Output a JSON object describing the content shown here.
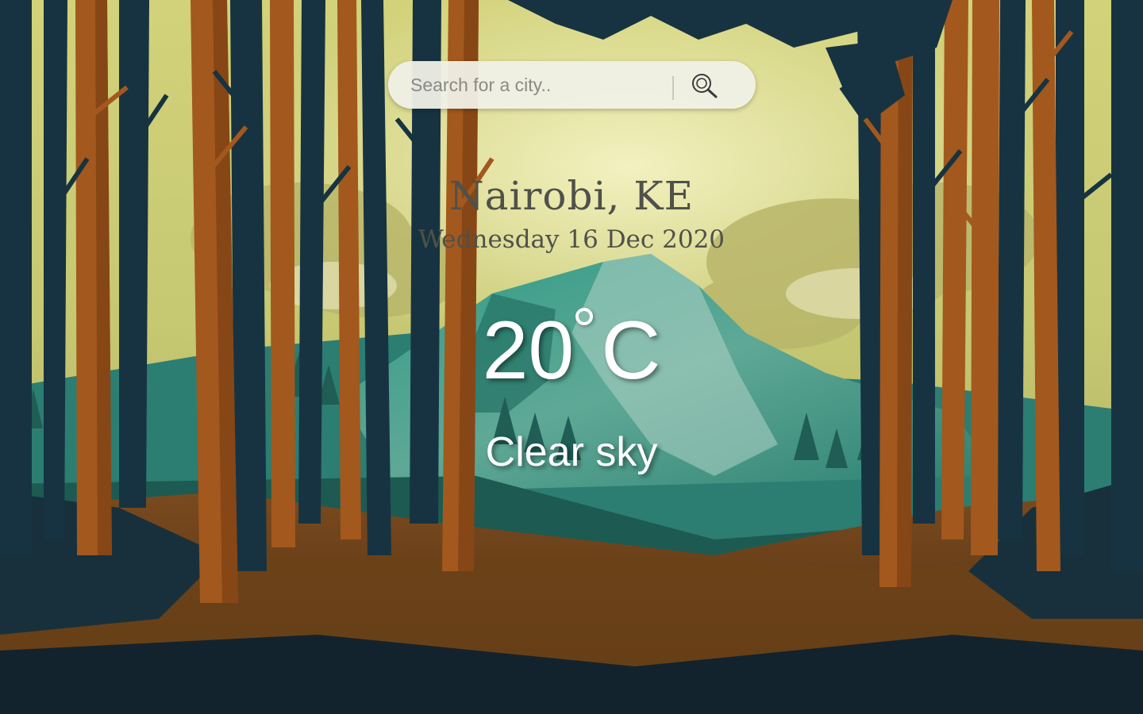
{
  "search": {
    "placeholder": "Search for a city..",
    "icon": "search-icon"
  },
  "location": {
    "city": "Nairobi, KE",
    "date": "Wednesday 16 Dec 2020"
  },
  "weather": {
    "temperature": "20",
    "unit": "C",
    "description": "Clear sky"
  }
}
